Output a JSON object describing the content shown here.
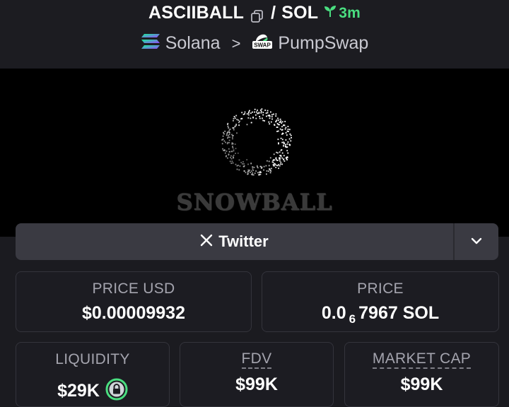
{
  "header": {
    "token_symbol": "ASCIIBALL",
    "separator": "/",
    "quote_symbol": "SOL",
    "age": "3m",
    "chain": "Solana",
    "breadcrumb_separator": ">",
    "dex": "PumpSwap",
    "dex_logo_text": "SWAP"
  },
  "banner": {
    "text": "SNOWBALL"
  },
  "social": {
    "twitter_label": "Twitter"
  },
  "stats": {
    "price_usd": {
      "label": "PRICE USD",
      "value": "$0.00009932"
    },
    "price": {
      "label": "PRICE",
      "value_prefix": "0.0",
      "value_subscript": "6",
      "value_suffix": "7967 SOL"
    },
    "liquidity": {
      "label": "LIQUIDITY",
      "value": "$29K"
    },
    "fdv": {
      "label": "FDV",
      "value": "$99K"
    },
    "market_cap": {
      "label": "MARKET CAP",
      "value": "$99K"
    }
  },
  "colors": {
    "accent_green": "#4ade80",
    "background": "#1b1b20",
    "banner_bg": "#000000",
    "card_border": "#34343c"
  }
}
